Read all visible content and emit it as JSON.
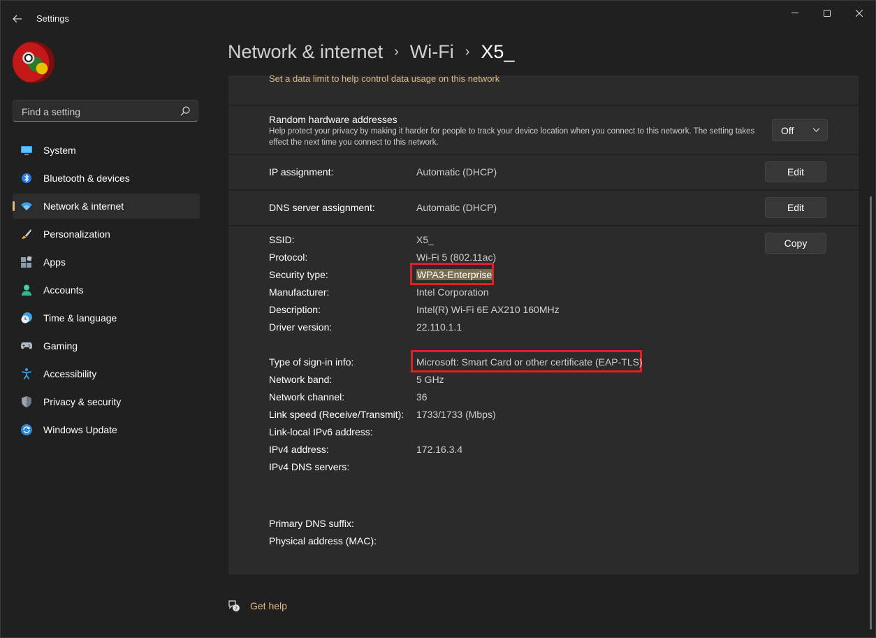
{
  "window": {
    "title": "Settings"
  },
  "search": {
    "placeholder": "Find a setting"
  },
  "sidebar": {
    "items": [
      {
        "label": "System",
        "icon": "monitor-icon"
      },
      {
        "label": "Bluetooth & devices",
        "icon": "bluetooth-icon"
      },
      {
        "label": "Network & internet",
        "icon": "wifi-icon",
        "active": true
      },
      {
        "label": "Personalization",
        "icon": "brush-icon"
      },
      {
        "label": "Apps",
        "icon": "apps-icon"
      },
      {
        "label": "Accounts",
        "icon": "person-icon"
      },
      {
        "label": "Time & language",
        "icon": "clock-globe-icon"
      },
      {
        "label": "Gaming",
        "icon": "gamepad-icon"
      },
      {
        "label": "Accessibility",
        "icon": "accessibility-icon"
      },
      {
        "label": "Privacy & security",
        "icon": "shield-icon"
      },
      {
        "label": "Windows Update",
        "icon": "update-icon"
      }
    ]
  },
  "breadcrumb": {
    "level1": "Network & internet",
    "level2": "Wi-Fi",
    "current": "X5_"
  },
  "data_limit": {
    "link": "Set a data limit to help control data usage on this network"
  },
  "random_hw": {
    "title": "Random hardware addresses",
    "desc": "Help protect your privacy by making it harder for people to track your device location when you connect to this network. The setting takes effect the next time you connect to this network.",
    "value": "Off"
  },
  "ip_assignment": {
    "label": "IP assignment:",
    "value": "Automatic (DHCP)",
    "button": "Edit"
  },
  "dns_assignment": {
    "label": "DNS server assignment:",
    "value": "Automatic (DHCP)",
    "button": "Edit"
  },
  "properties": {
    "copy_button": "Copy",
    "ssid": {
      "label": "SSID:",
      "value": "X5_"
    },
    "protocol": {
      "label": "Protocol:",
      "value": "Wi-Fi 5 (802.11ac)"
    },
    "security": {
      "label": "Security type:",
      "value": "WPA3-Enterprise"
    },
    "manufacturer": {
      "label": "Manufacturer:",
      "value": "Intel Corporation"
    },
    "description": {
      "label": "Description:",
      "value": "Intel(R) Wi-Fi 6E AX210 160MHz"
    },
    "driver": {
      "label": "Driver version:",
      "value": "22.110.1.1"
    },
    "signin": {
      "label": "Type of sign-in info:",
      "value": "Microsoft: Smart Card or other certificate (EAP-TLS)"
    },
    "band": {
      "label": "Network band:",
      "value": "5 GHz"
    },
    "channel": {
      "label": "Network channel:",
      "value": "36"
    },
    "link_speed": {
      "label": "Link speed (Receive/Transmit):",
      "value": "1733/1733 (Mbps)"
    },
    "ipv6": {
      "label": "Link-local IPv6 address:"
    },
    "ipv4": {
      "label": "IPv4 address:",
      "value": "172.16.3.4"
    },
    "ipv4_dns": {
      "label": "IPv4 DNS servers:"
    },
    "dns_suffix": {
      "label": "Primary DNS suffix:"
    },
    "mac": {
      "label": "Physical address (MAC):"
    }
  },
  "get_help": {
    "label": "Get help"
  },
  "colors": {
    "accent": "#e3b887",
    "highlight_border": "#e31e24",
    "background": "#202020",
    "card": "#2b2b2b"
  }
}
